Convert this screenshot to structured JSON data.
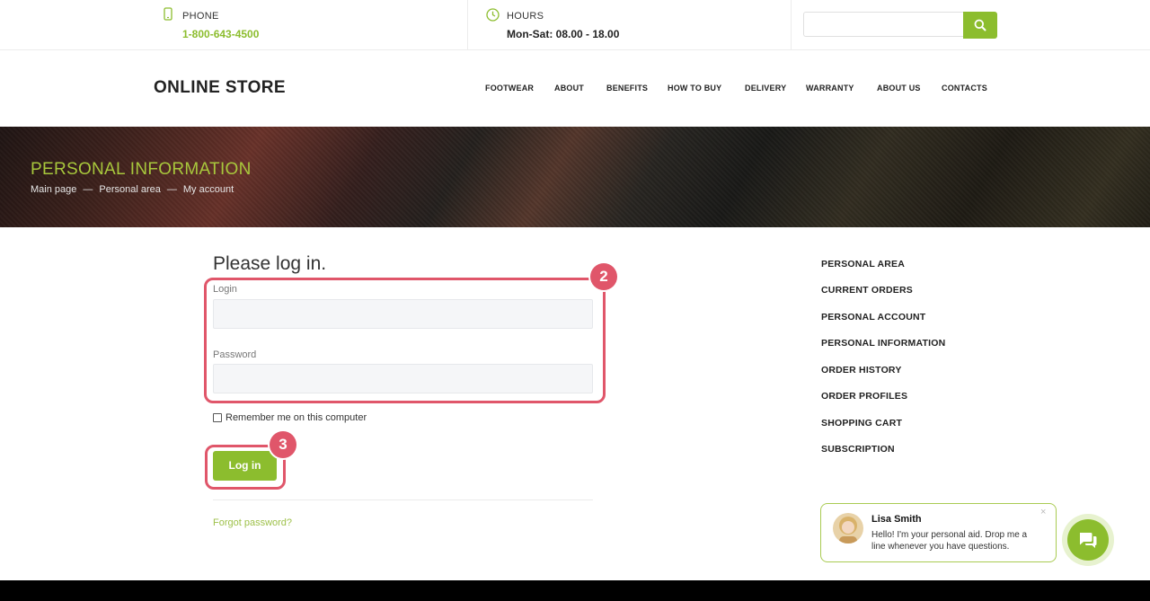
{
  "colors": {
    "accent": "#8cbd2e",
    "highlight": "#e0566a",
    "banner_title": "#a8c83c"
  },
  "topbar": {
    "phone": {
      "label": "PHONE",
      "value": "1-800-643-4500",
      "icon": "phone-icon"
    },
    "hours": {
      "label": "HOURS",
      "value": "Mon-Sat: 08.00 - 18.00",
      "icon": "clock-icon"
    },
    "search": {
      "placeholder": "",
      "icon": "search-icon"
    }
  },
  "header": {
    "logo": "ONLINE STORE",
    "nav": [
      "FOOTWEAR",
      "ABOUT",
      "BENEFITS",
      "HOW TO BUY",
      "DELIVERY",
      "WARRANTY",
      "ABOUT US",
      "CONTACTS"
    ]
  },
  "banner": {
    "title": "PERSONAL INFORMATION",
    "breadcrumbs": [
      "Main page",
      "Personal area",
      "My account"
    ],
    "separator": "—"
  },
  "form": {
    "title": "Please log in.",
    "login_label": "Login",
    "login_value": "",
    "password_label": "Password",
    "password_value": "",
    "remember_label": "Remember me on this computer",
    "submit_label": "Log in",
    "forgot_label": "Forgot password?"
  },
  "annotations": {
    "badge_fields": "2",
    "badge_submit": "3"
  },
  "sidebar": {
    "items": [
      "PERSONAL AREA",
      "CURRENT ORDERS",
      "PERSONAL ACCOUNT",
      "PERSONAL INFORMATION",
      "ORDER HISTORY",
      "ORDER PROFILES",
      "SHOPPING CART",
      "SUBSCRIPTION"
    ]
  },
  "chat": {
    "name": "Lisa Smith",
    "message": "Hello! I'm your personal aid. Drop me a line whenever you have questions.",
    "close": "×"
  }
}
